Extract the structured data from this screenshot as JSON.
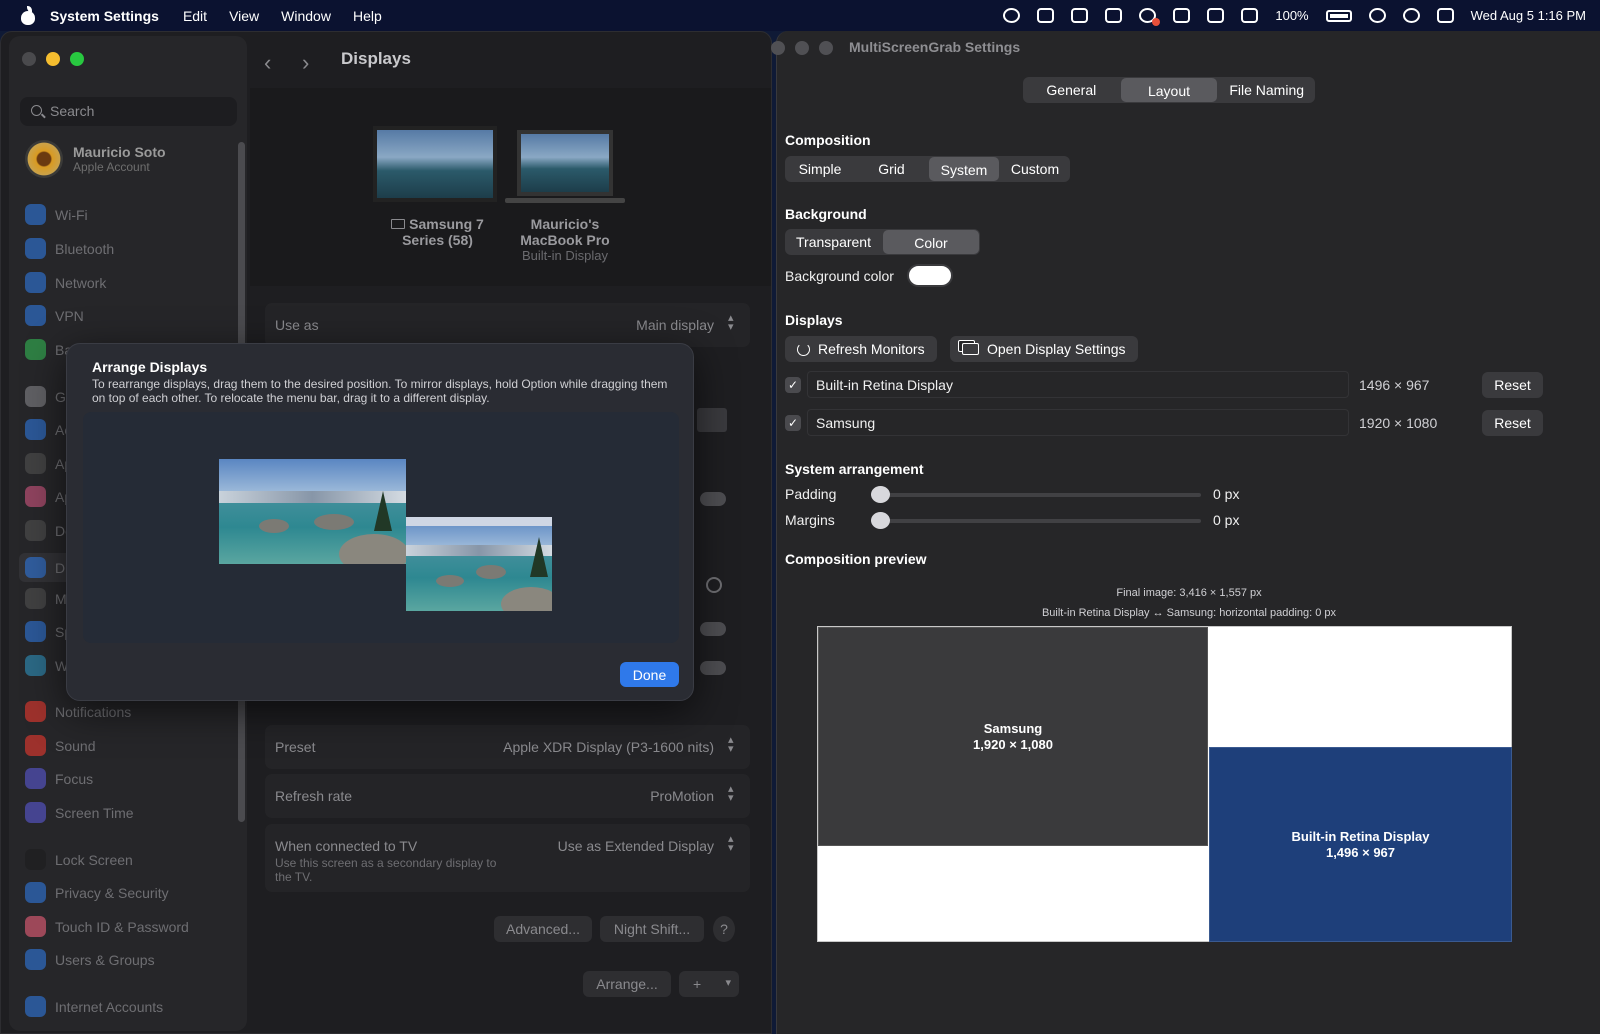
{
  "menubar": {
    "app_name": "System Settings",
    "menus": [
      "Edit",
      "View",
      "Window",
      "Help"
    ],
    "battery": "100%",
    "clock": "Wed Aug 5  1:16 PM"
  },
  "settings": {
    "search_placeholder": "Search",
    "account": {
      "name": "Mauricio Soto",
      "subtitle": "Apple Account"
    },
    "sidebar": [
      "Wi-Fi",
      "Bluetooth",
      "Network",
      "VPN",
      "Batt",
      "Ge",
      "Ac",
      "Ap",
      "Ap",
      "De",
      "Di",
      "M",
      "Sp",
      "W",
      "Notifications",
      "Sound",
      "Focus",
      "Screen Time",
      "Lock Screen",
      "Privacy & Security",
      "Touch ID & Password",
      "Users & Groups",
      "Internet Accounts"
    ],
    "pane_title": "Displays",
    "monitors": [
      {
        "name": "Samsung 7 Series (58)",
        "sub": ""
      },
      {
        "name": "Mauricio's MacBook Pro",
        "sub": "Built-in Display"
      }
    ],
    "rows": {
      "use_as": {
        "label": "Use as",
        "value": "Main display"
      },
      "preset": {
        "label": "Preset",
        "value": "Apple XDR Display (P3-1600 nits)"
      },
      "refresh": {
        "label": "Refresh rate",
        "value": "ProMotion"
      },
      "tv": {
        "label": "When connected to TV",
        "value": "Use as Extended Display",
        "sub": "Use this screen as a secondary display to the TV."
      }
    },
    "buttons": {
      "advanced": "Advanced...",
      "night_shift": "Night Shift...",
      "help": "?",
      "arrange": "Arrange...",
      "add": "+"
    }
  },
  "modal": {
    "title": "Arrange Displays",
    "description": "To rearrange displays, drag them to the desired position. To mirror displays, hold Option while dragging them on top of each other. To relocate the menu bar, drag it to a different display.",
    "done": "Done"
  },
  "msg": {
    "title": "MultiScreenGrab Settings",
    "tabs": [
      "General",
      "Layout",
      "File Naming"
    ],
    "selected_tab": "Layout",
    "composition": {
      "heading": "Composition",
      "options": [
        "Simple",
        "Grid",
        "System",
        "Custom"
      ],
      "selected": "System"
    },
    "background": {
      "heading": "Background",
      "options": [
        "Transparent",
        "Color"
      ],
      "selected": "Color",
      "color_label": "Background color",
      "color": "#ffffff"
    },
    "displays": {
      "heading": "Displays",
      "refresh": "Refresh Monitors",
      "open_settings": "Open Display Settings",
      "list": [
        {
          "name": "Built-in Retina Display",
          "res": "1496 × 967",
          "checked": true,
          "reset": "Reset"
        },
        {
          "name": "Samsung",
          "res": "1920 × 1080",
          "checked": true,
          "reset": "Reset"
        }
      ]
    },
    "arrangement": {
      "heading": "System arrangement",
      "padding_label": "Padding",
      "padding_value": "0 px",
      "margins_label": "Margins",
      "margins_value": "0 px"
    },
    "preview": {
      "heading": "Composition preview",
      "final_image": "Final image: 3,416 × 1,557 px",
      "padding_info": "Built-in Retina Display ↔ Samsung: horizontal padding: 0 px",
      "samsung": {
        "name": "Samsung",
        "res": "1,920 × 1,080",
        "color": "#3a3a3c"
      },
      "builtin": {
        "name": "Built-in Retina Display",
        "res": "1,496 × 967",
        "color": "#1e3f7a"
      }
    }
  }
}
